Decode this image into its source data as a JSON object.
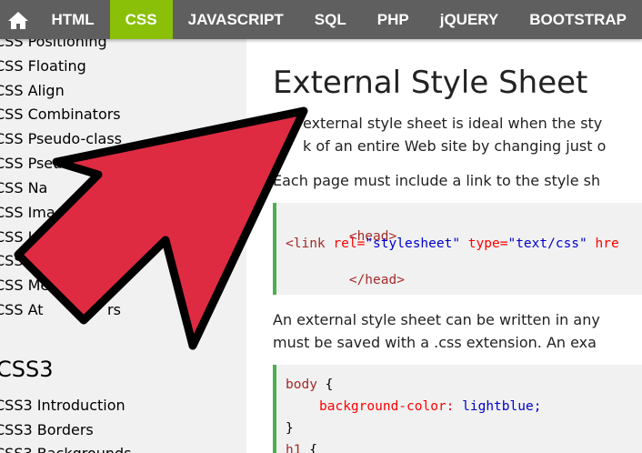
{
  "nav": {
    "home_icon": "home-icon",
    "items": [
      {
        "label": "HTML",
        "active": false
      },
      {
        "label": "CSS",
        "active": true
      },
      {
        "label": "JAVASCRIPT",
        "active": false
      },
      {
        "label": "SQL",
        "active": false
      },
      {
        "label": "PHP",
        "active": false
      },
      {
        "label": "jQUERY",
        "active": false
      },
      {
        "label": "BOOTSTRAP",
        "active": false
      }
    ],
    "active_color": "#8ac007",
    "bar_color": "#5f5f5f"
  },
  "sidebar": {
    "links": [
      "CSS Positioning",
      "CSS Floating",
      "CSS Align",
      "CSS Combinators",
      "CSS Pseudo-class",
      "CSS Pseudo-ele",
      "CSS Na",
      "CSS Image Ga",
      "CSS Image Opaci",
      "CSS Image S",
      "CSS Me",
      "CSS At",
      "rs"
    ],
    "css3_heading": "CSS3",
    "css3_links": [
      "CSS3 Introduction",
      "CSS3 Borders",
      "CSS3 Backgrounds"
    ]
  },
  "main": {
    "title": "External Style Sheet",
    "para1_line1": "external style sheet is ideal when the sty",
    "para1_line2": "k of an entire Web site by changing just o",
    "para2": "Each page must include a link to the style sh",
    "code1": {
      "line1_tag": "<head>",
      "line2_tag_open": "<link",
      "line2_attr1": " rel=",
      "line2_val1": "\"stylesheet\"",
      "line2_attr2": " type=",
      "line2_val2": "\"text/css\"",
      "line2_attr3": " hre",
      "line3_tag": "</head>"
    },
    "para3_line1": "An external style sheet can be written in any",
    "para3_line2": "must be saved with a .css extension. An exa",
    "code2": {
      "line1_sel": "body",
      "line1_brace": " {",
      "line2_prop": "background-color:",
      "line2_val": " lightblue;",
      "line3_brace": "}",
      "line4_sel": "h1",
      "line4_brace": " {"
    }
  },
  "overlay": {
    "arrow_icon": "red-arrow-pointer-icon",
    "arrow_color": "#de2b42"
  }
}
